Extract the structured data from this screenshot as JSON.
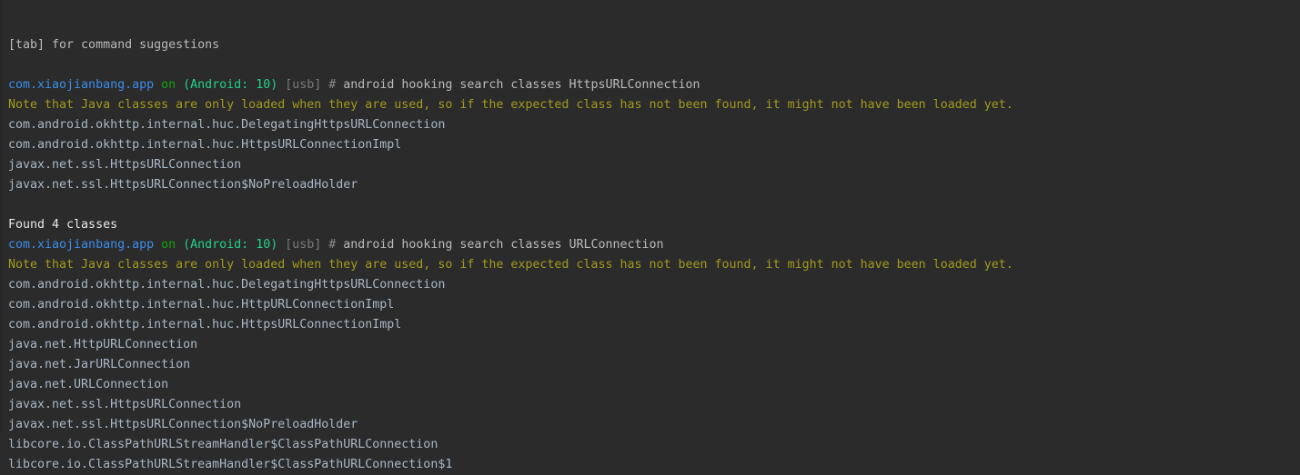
{
  "hint": "[tab] for command suggestions",
  "prompt": {
    "package": "com.xiaojianbang.app",
    "on": " on ",
    "device": "(Android: 10)",
    "transport": " [usb]",
    "hash": " # "
  },
  "note": "Note that Java classes are only loaded when they are used, so if the expected class has not been found, it might not have been loaded yet.",
  "blocks": [
    {
      "command": "android hooking search classes HttpsURLConnection",
      "results": [
        "com.android.okhttp.internal.huc.DelegatingHttpsURLConnection",
        "com.android.okhttp.internal.huc.HttpsURLConnectionImpl",
        "javax.net.ssl.HttpsURLConnection",
        "javax.net.ssl.HttpsURLConnection$NoPreloadHolder"
      ],
      "summary": "Found 4 classes"
    },
    {
      "command": "android hooking search classes URLConnection",
      "results": [
        "com.android.okhttp.internal.huc.DelegatingHttpsURLConnection",
        "com.android.okhttp.internal.huc.HttpURLConnectionImpl",
        "com.android.okhttp.internal.huc.HttpsURLConnectionImpl",
        "java.net.HttpURLConnection",
        "java.net.JarURLConnection",
        "java.net.URLConnection",
        "javax.net.ssl.HttpsURLConnection",
        "javax.net.ssl.HttpsURLConnection$NoPreloadHolder",
        "libcore.io.ClassPathURLStreamHandler$ClassPathURLConnection",
        "libcore.io.ClassPathURLStreamHandler$ClassPathURLConnection$1"
      ]
    }
  ],
  "colors": {
    "background": "#2b2b2b",
    "package": "#3b8eea",
    "device": "#23d18b",
    "note": "#a39a1e",
    "text": "#a9b7c6"
  }
}
